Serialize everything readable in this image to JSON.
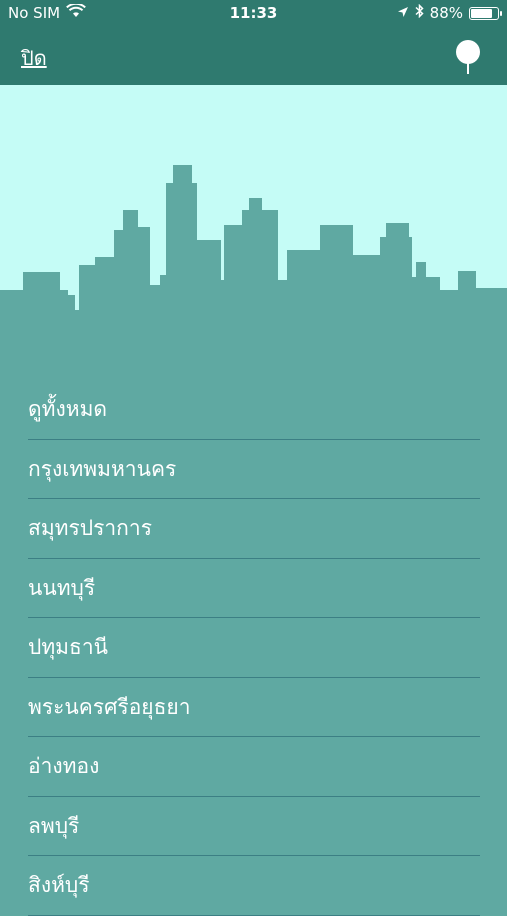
{
  "status_bar": {
    "carrier": "No SIM",
    "time": "11:33",
    "battery_percent": "88%",
    "battery_level": 0.88
  },
  "nav": {
    "close_label": "ปิด"
  },
  "menu": {
    "items": [
      {
        "label": "ดูทั้งหมด"
      },
      {
        "label": "กรุงเทพมหานคร"
      },
      {
        "label": "สมุทรปราการ"
      },
      {
        "label": "นนทบุรี"
      },
      {
        "label": "ปทุมธานี"
      },
      {
        "label": "พระนครศรีอยุธยา"
      },
      {
        "label": "อ่างทอง"
      },
      {
        "label": "ลพบุรี"
      },
      {
        "label": "สิงห์บุรี"
      }
    ]
  },
  "colors": {
    "header": "#2f7a6f",
    "sky": "#c5fcf6",
    "skyline": "#5fa9a2",
    "divider": "#3c7f84"
  }
}
